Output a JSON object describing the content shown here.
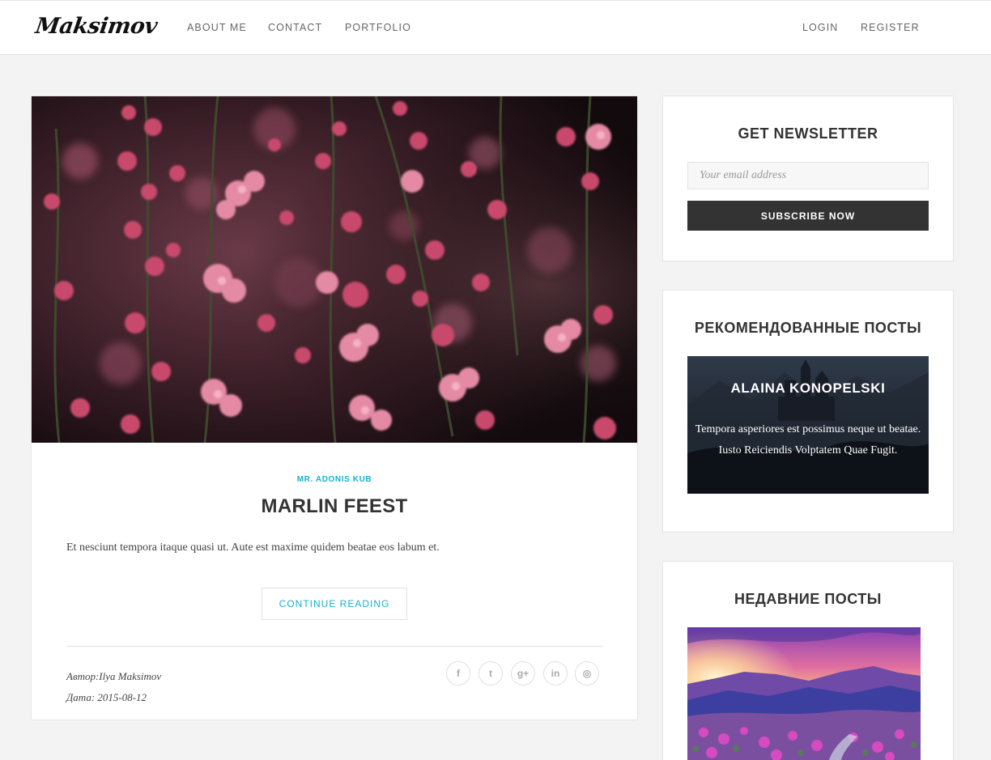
{
  "brand": {
    "logo_text": "Maksimov"
  },
  "nav": {
    "left": [
      "ABOUT ME",
      "CONTACT",
      "PORTFOLIO"
    ],
    "right": [
      "LOGIN",
      "REGISTER"
    ]
  },
  "post": {
    "category": "MR. ADONIS KUB",
    "title": "MARLIN FEEST",
    "excerpt": "Et nesciunt tempora itaque quasi ut. Aute est maxime quidem beatae eos labum et.",
    "read_more_label": "CONTINUE READING",
    "author_line": "Автор:Ilya Maksimov",
    "date_line": "Дата: 2015-08-12",
    "social_icons": [
      "facebook-icon",
      "twitter-icon",
      "google-plus-icon",
      "linkedin-icon",
      "instagram-icon"
    ],
    "social_glyphs": [
      "f",
      "t",
      "g+",
      "in",
      "◎"
    ]
  },
  "newsletter": {
    "title": "GET NEWSLETTER",
    "email_placeholder": "Your email address",
    "subscribe_label": "SUBSCRIBE NOW"
  },
  "recommended": {
    "title": "РЕКОМЕНДОВАННЫЕ ПОСТЫ",
    "card_name": "ALAINA KONOPELSKI",
    "card_text_line1": "Tempora asperiores est possimus neque ut beatae.",
    "card_text_line2": "Iusto Reiciendis Volptatem Quae Fugit."
  },
  "recent": {
    "title": "НЕДАВНИЕ ПОСТЫ"
  },
  "colors": {
    "accent": "#1ab0cf",
    "dark_button": "#333333",
    "page_bg": "#f3f3f3"
  }
}
